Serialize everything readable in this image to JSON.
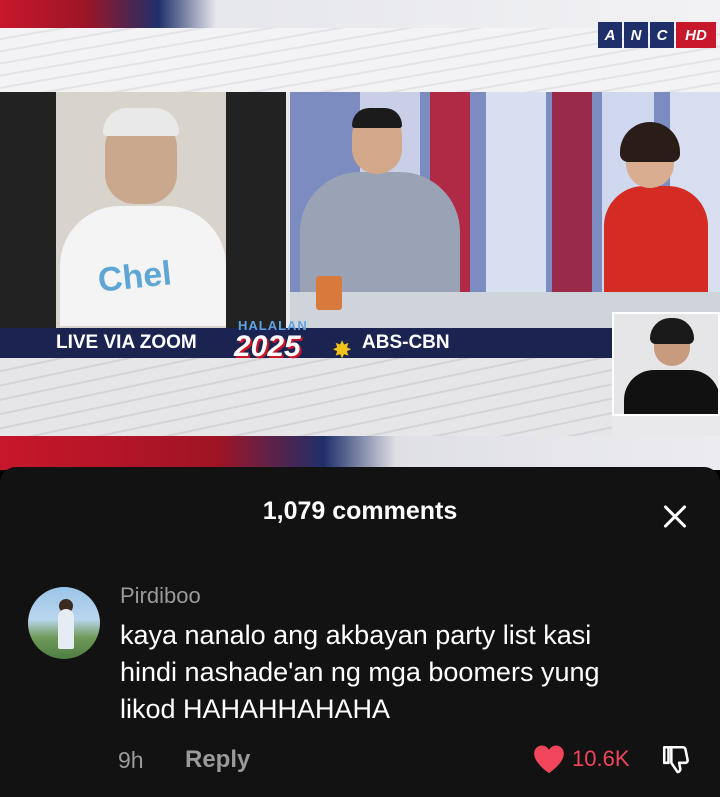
{
  "broadcast": {
    "channel_logo": [
      "A",
      "N",
      "C",
      "HD"
    ],
    "left_caption": "LIVE VIA ZOOM",
    "right_caption": "ABS-CBN",
    "event_logo_top": "HALALAN",
    "event_logo_year": "2025",
    "shirt_text": "Chel"
  },
  "comments": {
    "title": "1,079 comments",
    "items": [
      {
        "username": "Pirdiboo",
        "lines": [
          "kaya nanalo ang akbayan party list kasi",
          "hindi nashade'an ng mga boomers yung",
          "likod HAHAHHAHAHA"
        ],
        "time": "9h",
        "reply_label": "Reply",
        "likes": "10.6K"
      }
    ]
  },
  "colors": {
    "like": "#f0455a",
    "sheet_bg": "#121212",
    "brand_red": "#c8172b",
    "brand_navy": "#1f2f6a"
  },
  "icons": {
    "close": "close-icon",
    "like": "heart-icon",
    "dislike": "thumbs-down-icon"
  }
}
